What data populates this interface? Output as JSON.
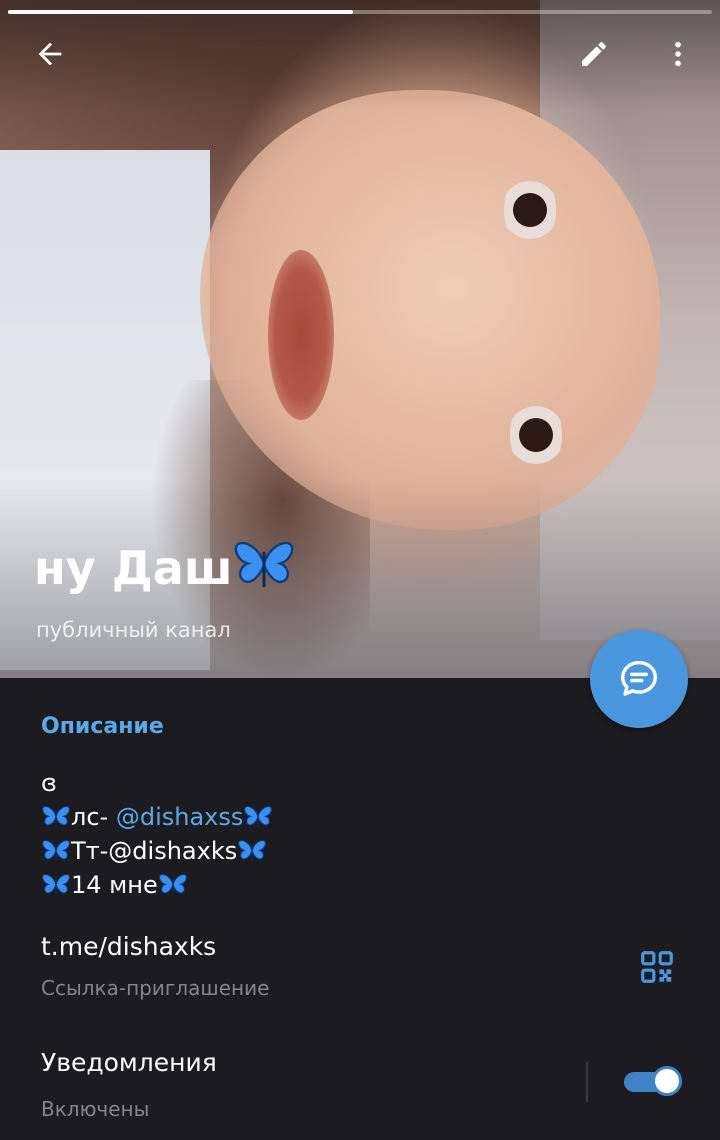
{
  "channel": {
    "title": "ну Даш",
    "subtitle": "публичный канал"
  },
  "story_progress": 0.49,
  "description": {
    "label": "Описание",
    "line1": "ɞ",
    "line2_prefix": "лс- ",
    "line2_mention": "@dishaxss",
    "line3": "Тт-@dishaxks",
    "line4": "14 мне"
  },
  "invite_link": {
    "value": "t.me/dishaxks",
    "caption": "Ссылка-приглашение"
  },
  "notifications": {
    "label": "Уведомления",
    "status": "Включены",
    "enabled": true
  },
  "colors": {
    "accent": "#5aa9ea",
    "fab": "#4a97e0",
    "background": "#1c1b1f",
    "muted_text": "#85848a"
  },
  "icons": {
    "back": "arrow-left-icon",
    "edit": "pencil-icon",
    "more": "more-vertical-icon",
    "fab": "chat-bubble-icon",
    "qr": "qr-code-icon",
    "decoration": "butterfly-emoji"
  }
}
